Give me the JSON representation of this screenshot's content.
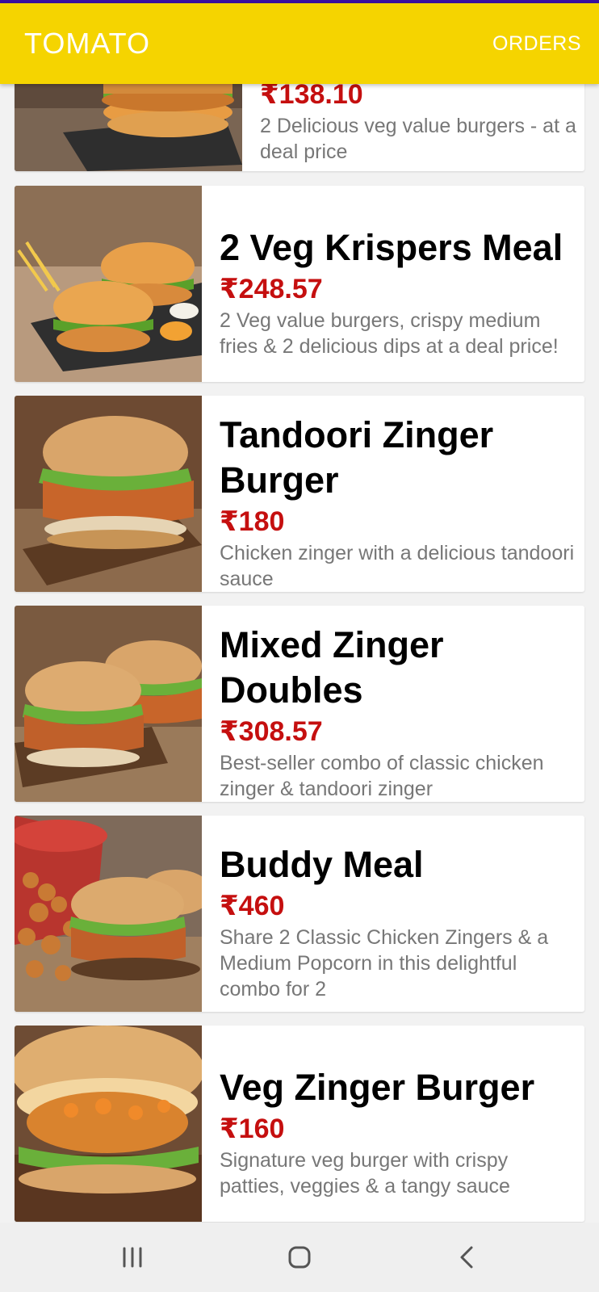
{
  "app_bar": {
    "title": "TOMATO",
    "orders_label": "ORDERS"
  },
  "items": [
    {
      "name": "",
      "price": "₹138.10",
      "description": "2 Delicious veg value burgers - at a deal price"
    },
    {
      "name": "2 Veg Krispers Meal",
      "price": "₹248.57",
      "description": "2 Veg value burgers, crispy medium fries & 2 delicious dips at a deal price!"
    },
    {
      "name": "Tandoori Zinger Burger",
      "price": "₹180",
      "description": "Chicken zinger with a delicious tandoori sauce"
    },
    {
      "name": "Mixed Zinger Doubles",
      "price": "₹308.57",
      "description": "Best-seller combo of classic chicken zinger & tandoori zinger"
    },
    {
      "name": "Buddy Meal",
      "price": "₹460",
      "description": "Share 2 Classic Chicken Zingers & a Medium Popcorn in this delightful combo for 2"
    },
    {
      "name": "Veg Zinger Burger",
      "price": "₹160",
      "description": "Signature veg burger with crispy patties, veggies & a tangy sauce"
    }
  ],
  "nav": {
    "recent": "recent-apps-icon",
    "home": "home-icon",
    "back": "back-icon"
  },
  "colors": {
    "app_bar": "#f5d400",
    "price": "#c50f0f",
    "status_strip": "#3b10a0"
  }
}
